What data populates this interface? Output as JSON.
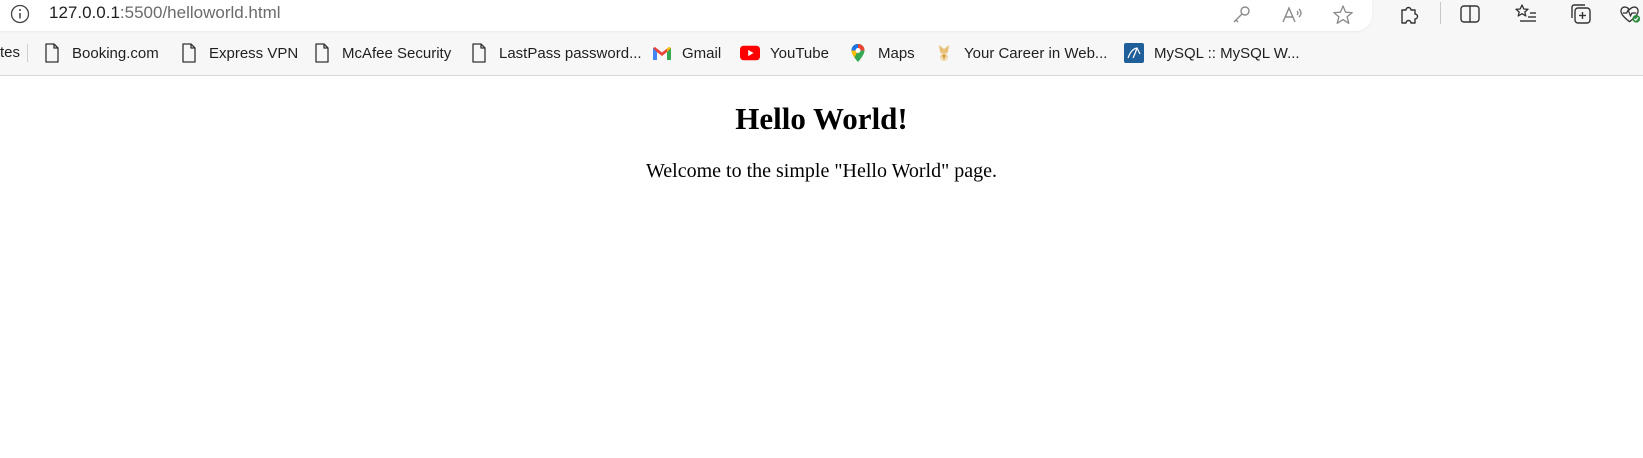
{
  "address_bar": {
    "url_host": "127.0.0.1",
    "url_rest": ":5500/helloworld.html"
  },
  "bookmarks": {
    "cut_label": "tes",
    "items": [
      {
        "label": "Booking.com",
        "icon": "page-icon"
      },
      {
        "label": "Express VPN",
        "icon": "page-icon"
      },
      {
        "label": "McAfee Security",
        "icon": "page-icon"
      },
      {
        "label": "LastPass password...",
        "icon": "page-icon"
      },
      {
        "label": "Gmail",
        "icon": "gmail-icon"
      },
      {
        "label": "YouTube",
        "icon": "youtube-icon"
      },
      {
        "label": "Maps",
        "icon": "maps-pin-icon"
      },
      {
        "label": "Your Career in Web...",
        "icon": "career-icon"
      },
      {
        "label": "MySQL :: MySQL W...",
        "icon": "mysql-icon"
      }
    ]
  },
  "page": {
    "heading": "Hello World!",
    "paragraph": "Welcome to the simple \"Hello World\" page."
  },
  "colors": {
    "chrome_bg": "#f7f7f7",
    "youtube_red": "#ff0000",
    "mysql_blue": "#1f5f9a"
  }
}
